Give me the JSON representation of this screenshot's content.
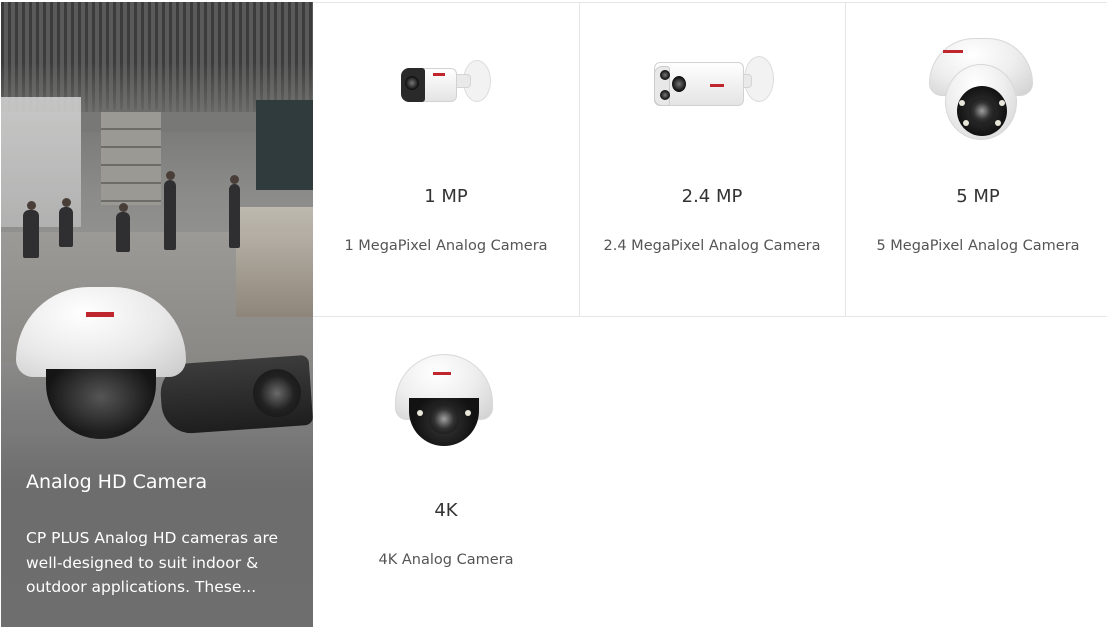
{
  "hero": {
    "title": "Analog HD Camera",
    "description": "CP PLUS Analog HD cameras are well-designed to suit indoor & outdoor applications. These..."
  },
  "products": [
    {
      "resolution": "1 MP",
      "name": "1 MegaPixel Analog Camera",
      "image": "bullet-camera-icon"
    },
    {
      "resolution": "2.4 MP",
      "name": "2.4 MegaPixel Analog Camera",
      "image": "long-bullet-camera-icon"
    },
    {
      "resolution": "5 MP",
      "name": "5 MegaPixel Analog Camera",
      "image": "dome-camera-icon"
    },
    {
      "resolution": "4K",
      "name": "4K Analog Camera",
      "image": "vandal-dome-camera-icon"
    }
  ],
  "colors": {
    "brand_red": "#c0262d",
    "text_dark": "#333333",
    "text_muted": "#555555",
    "divider": "#e6e6e6"
  }
}
